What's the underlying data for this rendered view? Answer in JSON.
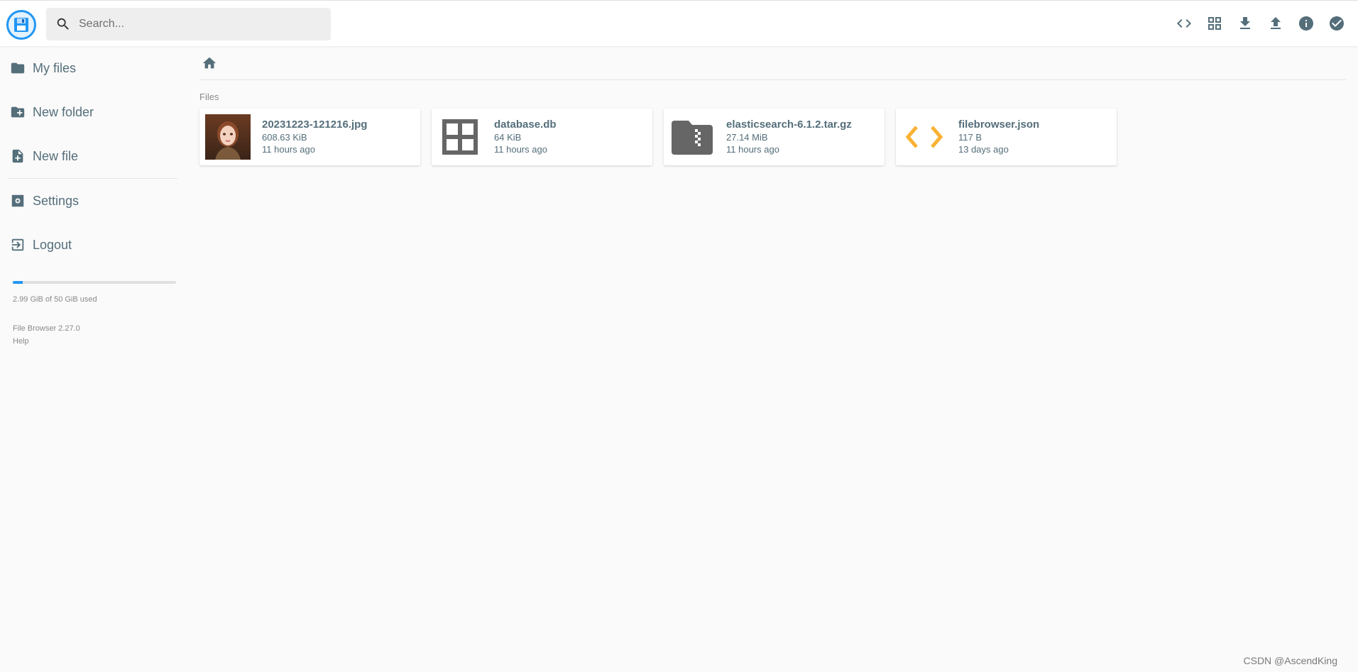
{
  "search": {
    "placeholder": "Search..."
  },
  "header": {
    "actions": [
      {
        "name": "toggle-view-code-icon"
      },
      {
        "name": "grid-view-icon"
      },
      {
        "name": "download-icon"
      },
      {
        "name": "upload-icon"
      },
      {
        "name": "info-icon"
      },
      {
        "name": "select-check-icon"
      }
    ]
  },
  "sidebar": {
    "items": [
      {
        "label": "My files",
        "icon": "folder-icon"
      },
      {
        "label": "New folder",
        "icon": "create-new-folder-icon"
      },
      {
        "label": "New file",
        "icon": "note-add-icon"
      },
      {
        "label": "Settings",
        "icon": "settings-icon"
      },
      {
        "label": "Logout",
        "icon": "exit-icon"
      }
    ],
    "quota": {
      "text": "2.99 GiB of 50 GiB used",
      "fraction": 0.06
    },
    "version": "File Browser 2.27.0",
    "help": "Help"
  },
  "main": {
    "section_title": "Files",
    "files": [
      {
        "name": "20231223-121216.jpg",
        "size": "608.63 KiB",
        "modified": "11 hours ago",
        "icon": "image-thumbnail"
      },
      {
        "name": "database.db",
        "size": "64 KiB",
        "modified": "11 hours ago",
        "icon": "grid-database-icon"
      },
      {
        "name": "elasticsearch-6.1.2.tar.gz",
        "size": "27.14 MiB",
        "modified": "11 hours ago",
        "icon": "archive-folder-icon"
      },
      {
        "name": "filebrowser.json",
        "size": "117 B",
        "modified": "13 days ago",
        "icon": "code-icon"
      }
    ]
  },
  "colors": {
    "accent": "#2196f3",
    "icon": "#546e7a",
    "code": "#f9a825"
  },
  "watermark": "CSDN @AscendKing"
}
